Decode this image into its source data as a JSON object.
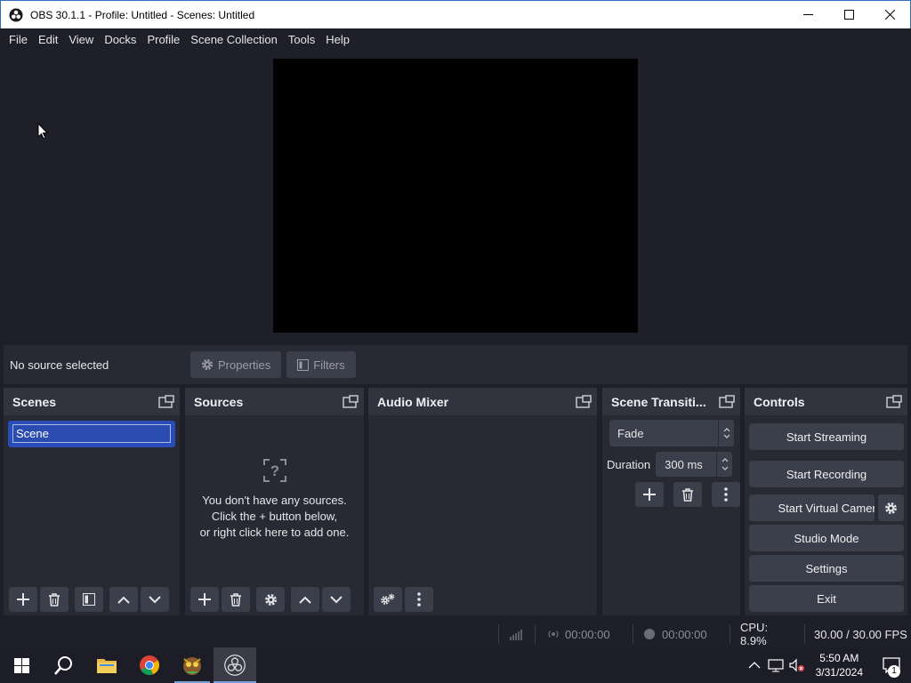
{
  "window": {
    "title": "OBS 30.1.1 - Profile: Untitled - Scenes: Untitled",
    "minimize": "—",
    "maximize": "☐",
    "close": "✕"
  },
  "menu": [
    "File",
    "Edit",
    "View",
    "Docks",
    "Profile",
    "Scene Collection",
    "Tools",
    "Help"
  ],
  "context": {
    "no_source": "No source selected",
    "properties": "Properties",
    "filters": "Filters"
  },
  "docks": {
    "scenes": {
      "title": "Scenes",
      "items": [
        "Scene"
      ]
    },
    "sources": {
      "title": "Sources",
      "empty_line1": "You don't have any sources.",
      "empty_line2": "Click the + button below,",
      "empty_line3": "or right click here to add one."
    },
    "audio": {
      "title": "Audio Mixer"
    },
    "transitions": {
      "title": "Scene Transiti...",
      "selected": "Fade",
      "duration_label": "Duration",
      "duration_value": "300 ms"
    },
    "controls": {
      "title": "Controls",
      "start_streaming": "Start Streaming",
      "start_recording": "Start Recording",
      "start_virtual_camera": "Start Virtual Camera",
      "studio_mode": "Studio Mode",
      "settings": "Settings",
      "exit": "Exit"
    }
  },
  "status": {
    "stream_time": "00:00:00",
    "record_time": "00:00:00",
    "cpu": "CPU: 8.9%",
    "fps": "30.00 / 30.00 FPS"
  },
  "taskbar": {
    "time": "5:50 AM",
    "date": "3/31/2024",
    "notifications": "1"
  }
}
